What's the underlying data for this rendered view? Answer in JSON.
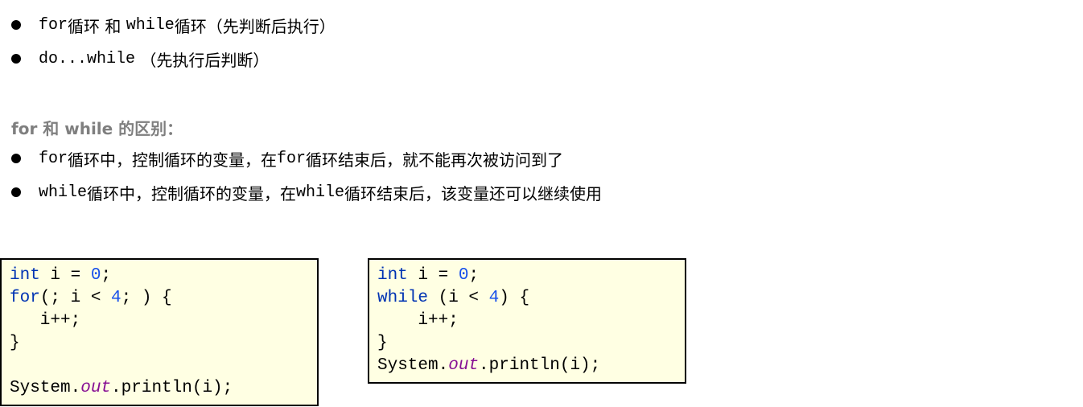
{
  "bullets_top": [
    {
      "code": "for",
      "text_after": "循环 和 ",
      "code2": "while",
      "text_end": "循环（先判断后执行）"
    },
    {
      "code": "do...while",
      "text_after": " （先执行后判断）",
      "code2": "",
      "text_end": ""
    }
  ],
  "subtitle": "for 和 while 的区别：",
  "bullets_diff": [
    {
      "code": "for",
      "text_after": "循环中，控制循环的变量，在",
      "code2": "for",
      "text_end": "循环结束后，就不能再次被访问到了"
    },
    {
      "code": "while",
      "text_after": "循环中，控制循环的变量，在",
      "code2": "while",
      "text_end": "循环结束后，该变量还可以继续使用"
    }
  ],
  "code_for": {
    "line1": {
      "kw": "int",
      "mid": " i = ",
      "num": "0",
      "end": ";"
    },
    "line2": {
      "kw": "for",
      "mid": "(; i < ",
      "num": "4",
      "end": "; ) {"
    },
    "line3": "   i++;",
    "line4": "}",
    "line5": "",
    "line6": {
      "pre": "System.",
      "field": "out",
      "post": ".println(i);"
    }
  },
  "code_while": {
    "line1": {
      "kw": "int",
      "mid": " i = ",
      "num": "0",
      "end": ";"
    },
    "line2": {
      "kw": "while",
      "mid": " (i < ",
      "num": "4",
      "end": ") {"
    },
    "line3": "    i++;",
    "line4": "}",
    "line5": {
      "pre": "System.",
      "field": "out",
      "post": ".println(i);"
    }
  }
}
